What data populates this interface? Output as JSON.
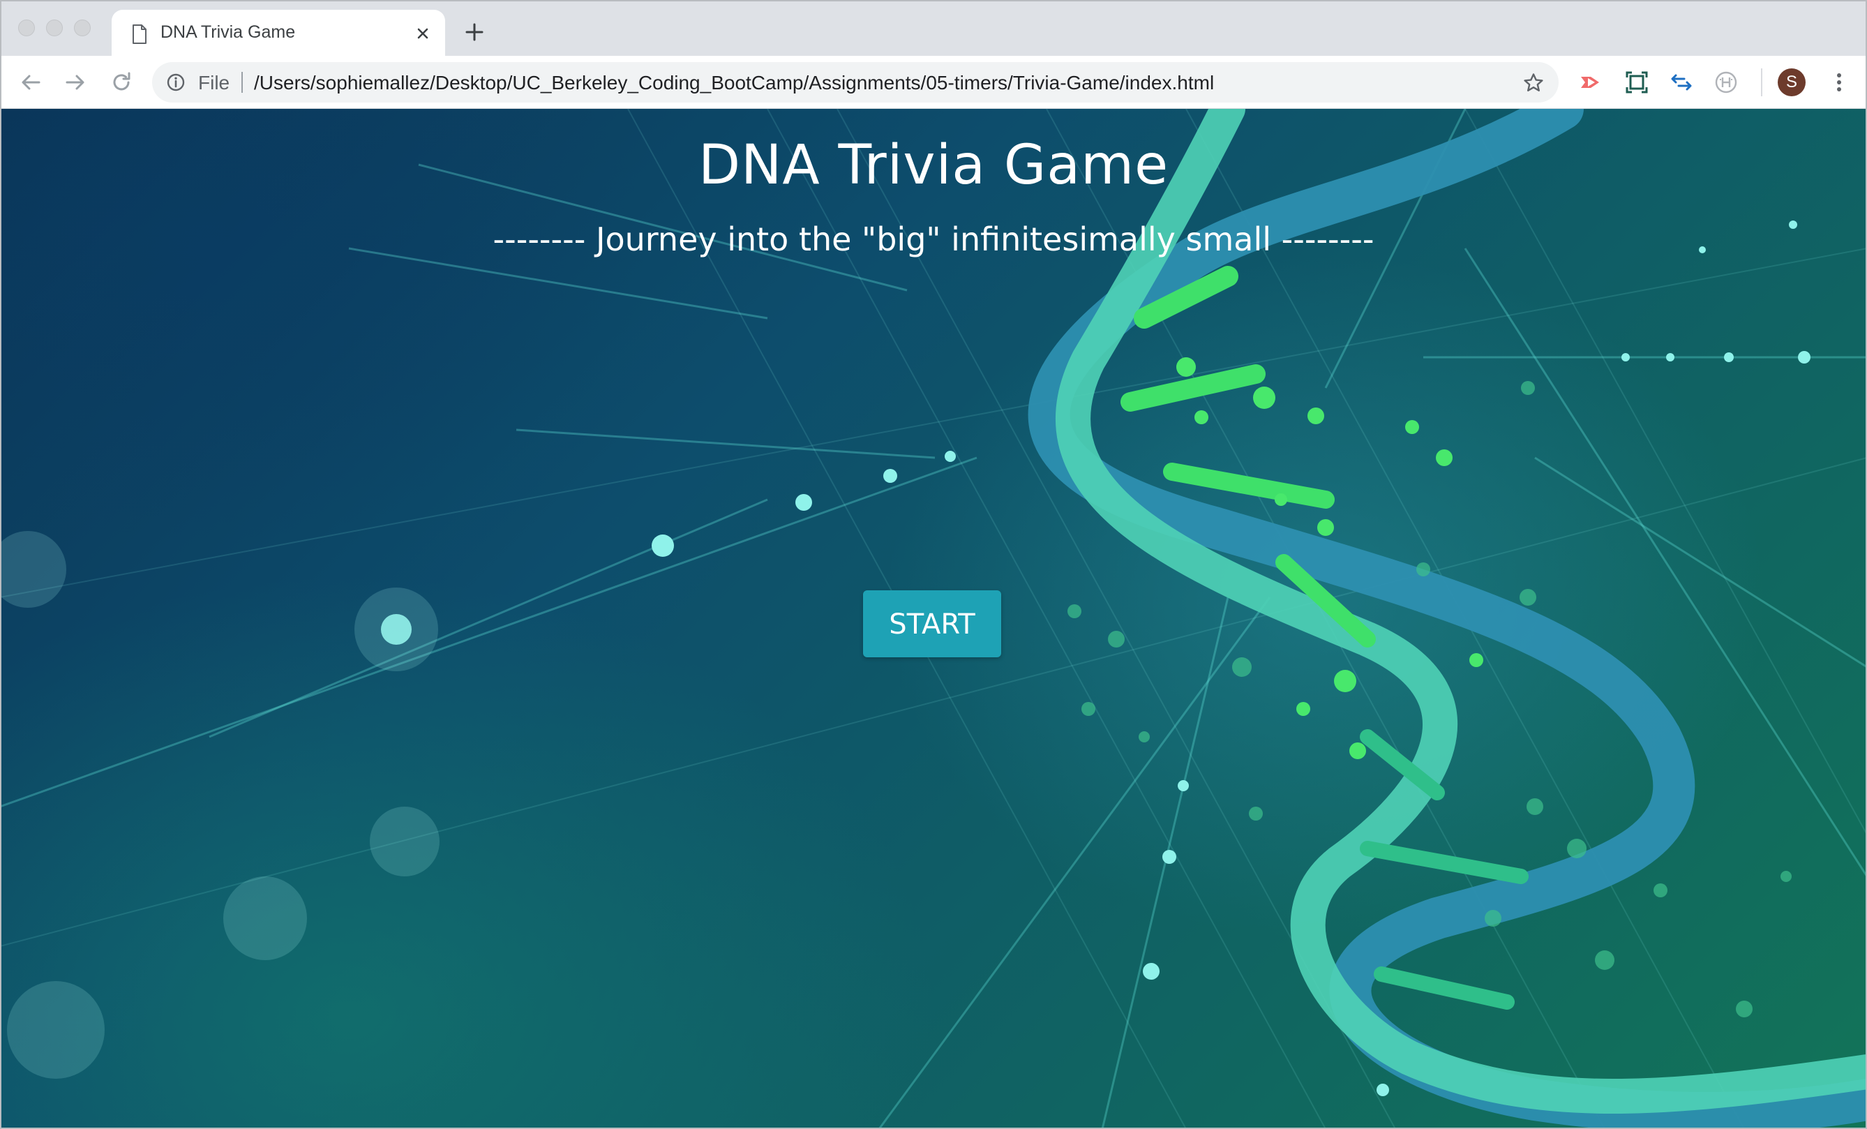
{
  "browser": {
    "tab": {
      "title": "DNA Trivia Game",
      "icon": "document-icon"
    },
    "new_tab_icon": "plus-icon",
    "toolbar": {
      "back_icon": "arrow-left-icon",
      "forward_icon": "arrow-right-icon",
      "reload_icon": "reload-icon",
      "site_info_icon": "info-icon",
      "scheme_label": "File",
      "url": "/Users/sophiemallez/Desktop/UC_Berkeley_Coding_BootCamp/Assignments/05-timers/Trivia-Game/index.html",
      "bookmark_icon": "star-icon",
      "extensions": [
        "red-play-extension-icon",
        "screenshot-extension-icon",
        "swap-arrows-extension-icon",
        "h-extension-icon"
      ],
      "profile_initial": "S",
      "menu_icon": "kebab-menu-icon"
    }
  },
  "page": {
    "title": "DNA Trivia Game",
    "subtitle": "-------- Journey into the \"big\" infinitesimally small --------",
    "start_button": "START"
  },
  "colors": {
    "start_button": "#1ea2b5",
    "background_dark": "#0a3457",
    "background_teal": "#0f5d66",
    "dna_green": "#3fe06a",
    "dna_blue": "#2f8fb5",
    "avatar": "#6d3b2c"
  }
}
